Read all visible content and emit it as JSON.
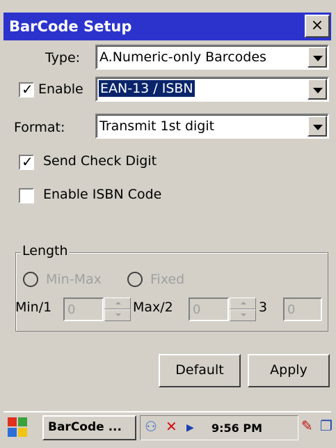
{
  "window": {
    "title": "BarCode Setup",
    "close_label": "×"
  },
  "type_row": {
    "label": "Type:",
    "value": "A.Numeric-only Barcodes"
  },
  "enable_row": {
    "label": "Enable",
    "checked": true,
    "value": "EAN-13 / ISBN"
  },
  "format_row": {
    "label": "Format:",
    "value": "Transmit 1st digit"
  },
  "send_check_digit": {
    "label": "Send Check Digit",
    "checked": true
  },
  "enable_isbn": {
    "label": "Enable ISBN Code",
    "checked": false
  },
  "length_group": {
    "label": "Length",
    "radio_minmax": "Min-Max",
    "radio_fixed": "Fixed",
    "min_label": "Min/1",
    "min_value": "0",
    "max_label": "Max/2",
    "max_value": "0",
    "third_label": "3",
    "third_value": "0"
  },
  "buttons": {
    "default": "Default",
    "apply": "Apply"
  },
  "taskbar": {
    "task_label": "BarCode ...",
    "time": "9:56 PM",
    "tray_icons": [
      "network-icon",
      "no-signal-icon",
      "arrow-icon",
      "input-panel-icon",
      "window-switch-icon"
    ]
  },
  "colors": {
    "title_bar": "#2b33cc",
    "selection": "#0a246a",
    "face": "#d4d0c8"
  }
}
